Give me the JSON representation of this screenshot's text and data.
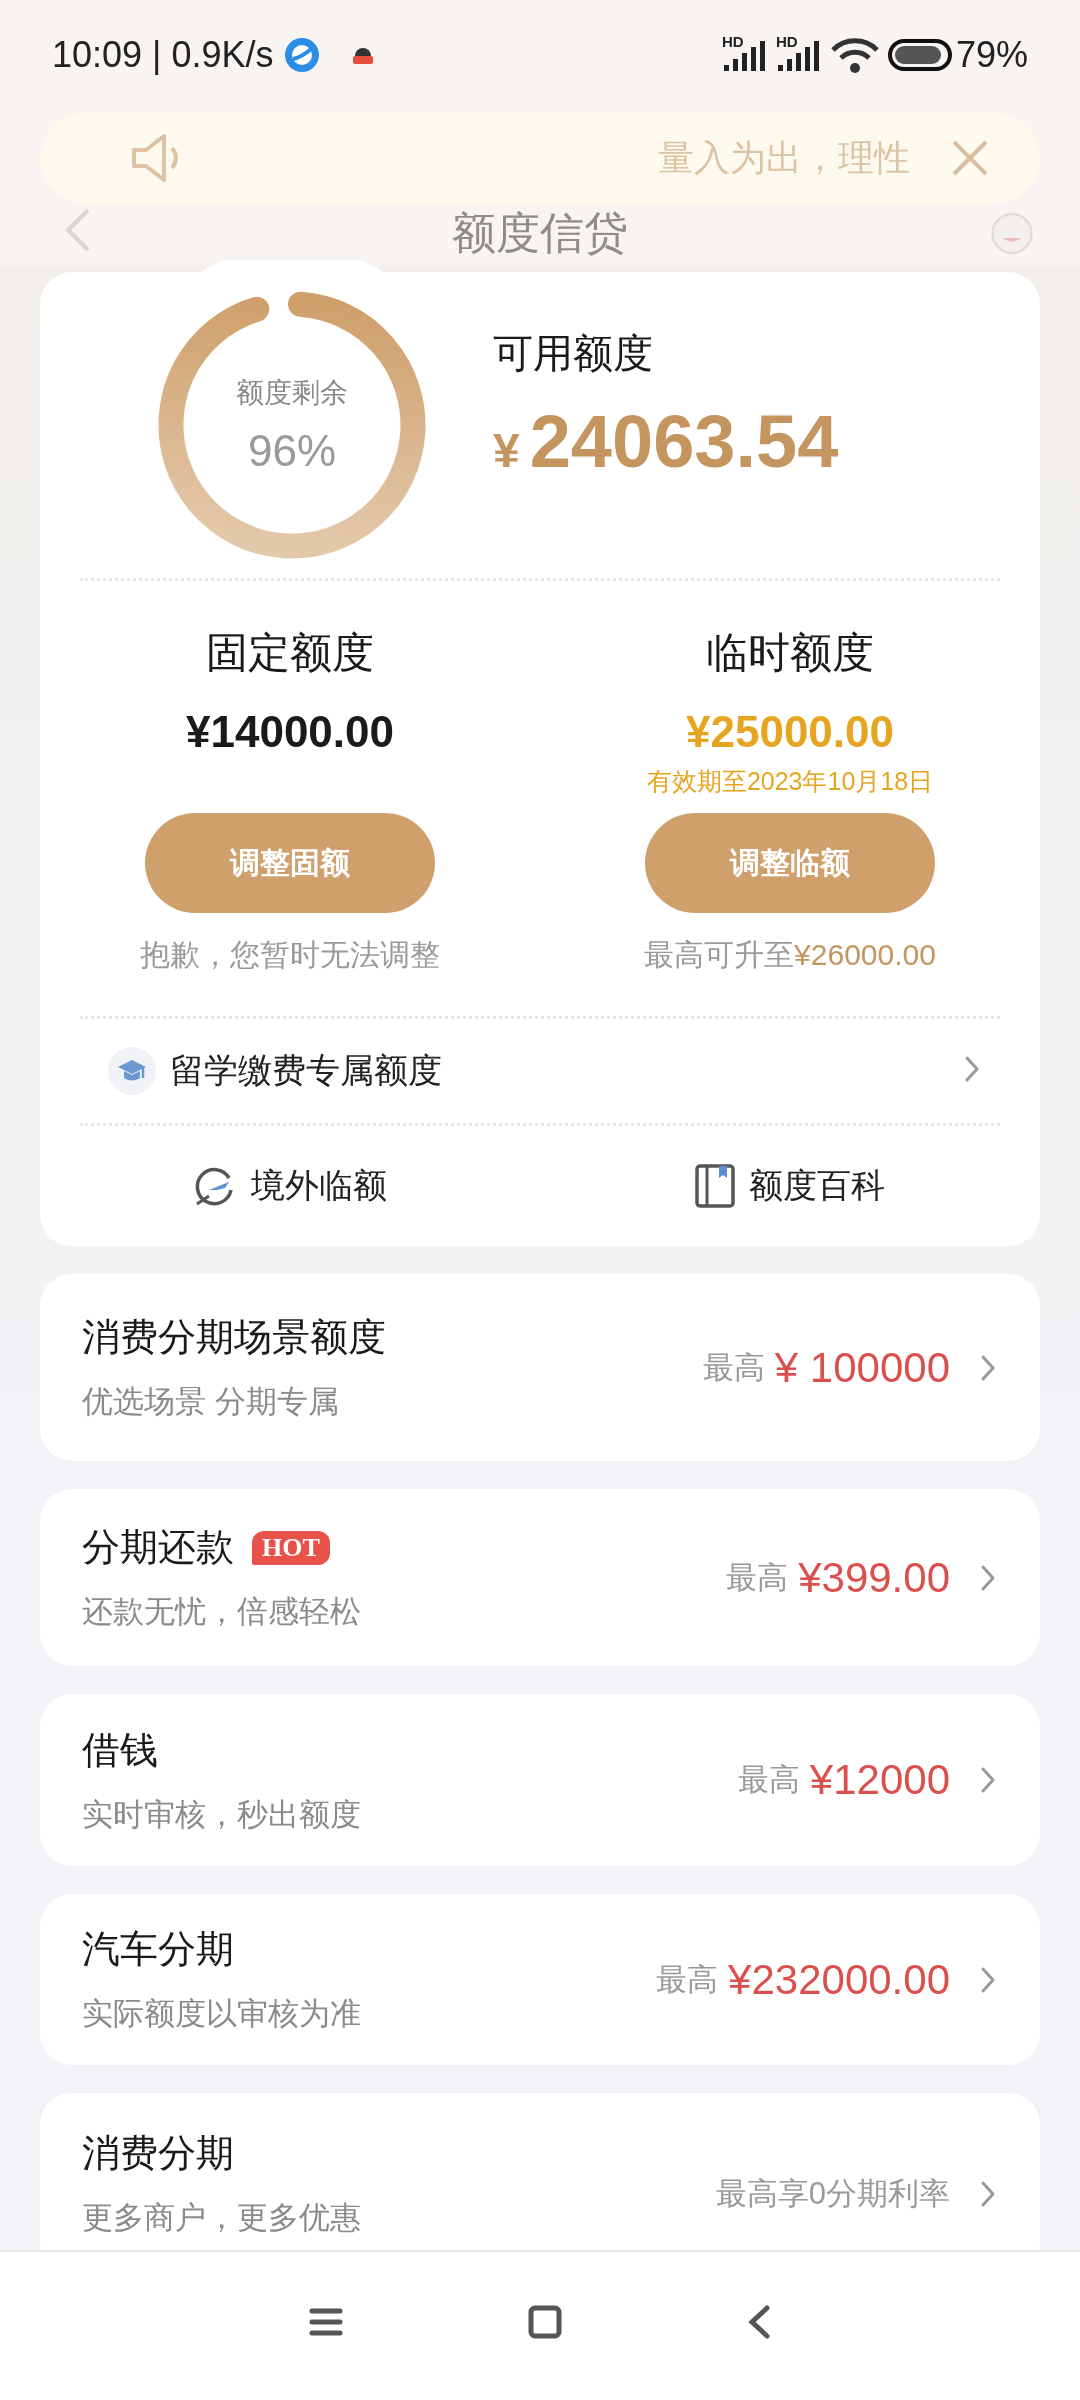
{
  "status_bar": {
    "time": "10:09",
    "separator": "|",
    "speed": "0.9K/s",
    "signal_labels": [
      "HD",
      "HD"
    ],
    "battery": "79%"
  },
  "header": {
    "title": "额度信贷",
    "notice": "量入为出，理性"
  },
  "credit": {
    "ring_label": "额度剩余",
    "ring_percent": "96%",
    "available_label": "可用额度",
    "currency": "¥",
    "available_amount": "24063.54",
    "columns": [
      {
        "kind": "fixed",
        "title": "固定额度",
        "amount": "¥14000.00",
        "button": "调整固额",
        "note": "抱歉，您暂时无法调整"
      },
      {
        "kind": "temporary",
        "title": "临时额度",
        "amount": "¥25000.00",
        "validity": "有效期至2023年10月18日",
        "button": "调整临额",
        "note": "最高可升至",
        "note_amount": "¥26000.00"
      }
    ],
    "study_row": {
      "label": "留学缴费专属额度"
    },
    "links": [
      {
        "kind": "plane",
        "label": "境外临额"
      },
      {
        "kind": "book",
        "label": "额度百科"
      }
    ]
  },
  "products": [
    {
      "title": "消费分期场景额度",
      "subtitle": "优选场景 分期专属",
      "prefix": "最高",
      "amount": "¥ 100000"
    },
    {
      "title": "分期还款",
      "badge": "HOT",
      "subtitle": "还款无忧，倍感轻松",
      "prefix": "最高",
      "amount": "¥399.00"
    },
    {
      "title": "借钱",
      "subtitle": "实时审核，秒出额度",
      "prefix": "最高",
      "amount": "¥12000"
    },
    {
      "title": "汽车分期",
      "subtitle": "实际额度以审核为准",
      "prefix": "最高",
      "amount": "¥232000.00"
    },
    {
      "title": "消费分期",
      "subtitle": "更多商户，更多优惠",
      "prefix": "最高享0分期利率"
    }
  ]
}
